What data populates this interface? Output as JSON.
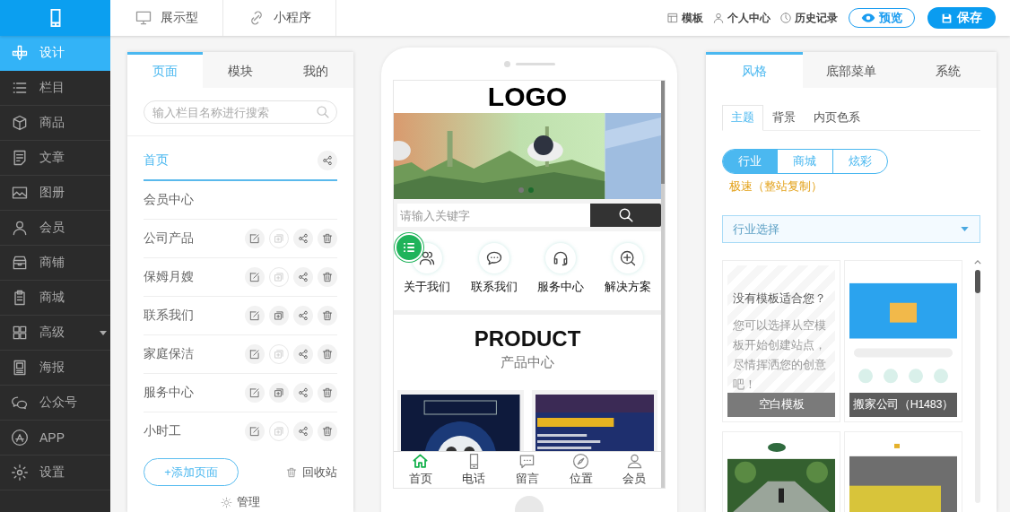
{
  "top_tabs": [
    {
      "label": "展示型"
    },
    {
      "label": "小程序"
    }
  ],
  "top_links": [
    {
      "label": "模板"
    },
    {
      "label": "个人中心"
    },
    {
      "label": "历史记录"
    }
  ],
  "preview_button": {
    "label": "预览"
  },
  "save_button": {
    "label": "保存"
  },
  "sidebar": {
    "items": [
      {
        "label": "设计",
        "selected": true,
        "submenu": false
      },
      {
        "label": "栏目",
        "selected": false,
        "submenu": false
      },
      {
        "label": "商品",
        "selected": false,
        "submenu": false
      },
      {
        "label": "文章",
        "selected": false,
        "submenu": false
      },
      {
        "label": "图册",
        "selected": false,
        "submenu": false
      },
      {
        "label": "会员",
        "selected": false,
        "submenu": false
      },
      {
        "label": "商铺",
        "selected": false,
        "submenu": false
      },
      {
        "label": "商城",
        "selected": false,
        "submenu": false
      },
      {
        "label": "高级",
        "selected": false,
        "submenu": true
      },
      {
        "label": "海报",
        "selected": false,
        "submenu": false
      },
      {
        "label": "公众号",
        "selected": false,
        "submenu": false
      },
      {
        "label": "APP",
        "selected": false,
        "submenu": false
      },
      {
        "label": "设置",
        "selected": false,
        "submenu": false
      }
    ]
  },
  "page_panel": {
    "tabs": [
      {
        "label": "页面",
        "selected": true
      },
      {
        "label": "模块",
        "selected": false
      },
      {
        "label": "我的",
        "selected": false
      }
    ],
    "search": {
      "placeholder": "输入栏目名称进行搜索"
    },
    "pages": [
      {
        "name": "首页",
        "selected": true,
        "actions": [
          {
            "kind": "share",
            "disabled": false
          }
        ]
      },
      {
        "name": "会员中心",
        "selected": false
      },
      {
        "name": "公司产品",
        "selected": false,
        "actions": [
          {
            "kind": "edit",
            "disabled": false
          },
          {
            "kind": "copy",
            "disabled": true
          },
          {
            "kind": "share",
            "disabled": false
          },
          {
            "kind": "delete",
            "disabled": false
          }
        ]
      },
      {
        "name": "保姆月嫂",
        "selected": false,
        "actions": [
          {
            "kind": "edit",
            "disabled": false
          },
          {
            "kind": "copy",
            "disabled": true
          },
          {
            "kind": "share",
            "disabled": false
          },
          {
            "kind": "delete",
            "disabled": false
          }
        ]
      },
      {
        "name": "联系我们",
        "selected": false,
        "actions": [
          {
            "kind": "edit",
            "disabled": false
          },
          {
            "kind": "copy",
            "disabled": false
          },
          {
            "kind": "share",
            "disabled": false
          },
          {
            "kind": "delete",
            "disabled": false
          }
        ]
      },
      {
        "name": "家庭保洁",
        "selected": false,
        "actions": [
          {
            "kind": "edit",
            "disabled": false
          },
          {
            "kind": "copy",
            "disabled": true
          },
          {
            "kind": "share",
            "disabled": false
          },
          {
            "kind": "delete",
            "disabled": false
          }
        ]
      },
      {
        "name": "服务中心",
        "selected": false,
        "actions": [
          {
            "kind": "edit",
            "disabled": false
          },
          {
            "kind": "copy",
            "disabled": false
          },
          {
            "kind": "share",
            "disabled": false
          },
          {
            "kind": "delete",
            "disabled": false
          }
        ]
      },
      {
        "name": "小时工",
        "selected": false,
        "actions": [
          {
            "kind": "edit",
            "disabled": false
          },
          {
            "kind": "copy",
            "disabled": true
          },
          {
            "kind": "share",
            "disabled": false
          },
          {
            "kind": "delete",
            "disabled": false
          }
        ]
      }
    ],
    "add_button": "+添加页面",
    "recycle_bin": "回收站",
    "manage": "管理"
  },
  "preview": {
    "logo": "LOGO",
    "search": {
      "placeholder": "请输入关键字"
    },
    "nav": [
      {
        "label": "关于我们"
      },
      {
        "label": "联系我们"
      },
      {
        "label": "服务中心"
      },
      {
        "label": "解决方案"
      }
    ],
    "section_title": "PRODUCT",
    "section_subtitle": "产品中心",
    "tabbar": [
      {
        "label": "首页",
        "selected": true
      },
      {
        "label": "电话",
        "selected": false
      },
      {
        "label": "留言",
        "selected": false
      },
      {
        "label": "位置",
        "selected": false
      },
      {
        "label": "会员",
        "selected": false
      }
    ]
  },
  "style_panel": {
    "tabs": [
      {
        "label": "风格",
        "selected": true
      },
      {
        "label": "底部菜单",
        "selected": false
      },
      {
        "label": "系统",
        "selected": false
      }
    ],
    "subtabs": [
      {
        "label": "主题",
        "selected": true
      },
      {
        "label": "背景",
        "selected": false
      },
      {
        "label": "内页色系",
        "selected": false
      }
    ],
    "segments": [
      {
        "label": "行业",
        "selected": true
      },
      {
        "label": "商城",
        "selected": false
      },
      {
        "label": "炫彩",
        "selected": false
      }
    ],
    "link": "极速（整站复制）",
    "select": {
      "placeholder": "行业选择"
    },
    "templates": [
      {
        "kind": "blank",
        "title": "没有模板适合您？",
        "text": "您可以选择从空模板开始创建站点，尽情挥洒您的创意吧！",
        "label": "空白模板"
      },
      {
        "kind": "picture",
        "label": "搬家公司（H1483）"
      },
      {
        "kind": "picture"
      },
      {
        "kind": "picture"
      }
    ]
  }
}
